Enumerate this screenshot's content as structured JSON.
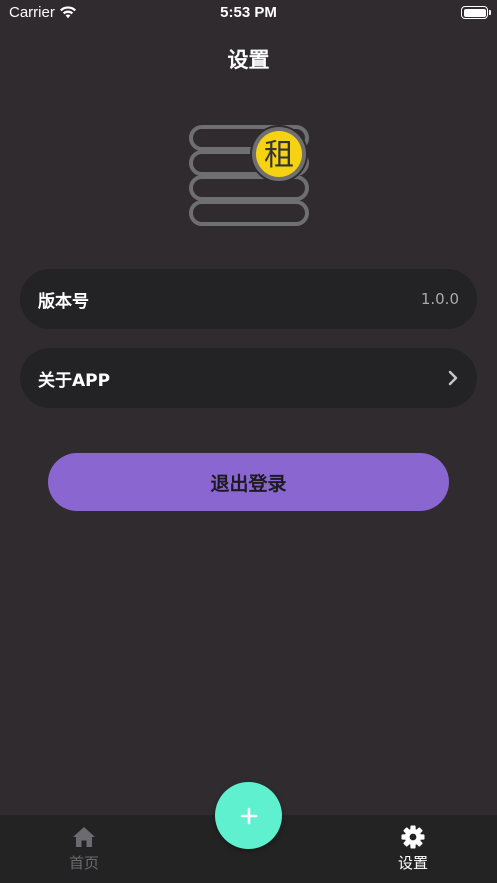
{
  "status_bar": {
    "carrier": "Carrier",
    "time": "5:53 PM",
    "wifi_icon": "wifi-icon",
    "battery_icon": "battery-icon"
  },
  "header": {
    "title": "设置"
  },
  "logo": {
    "icon": "rent-ledger-logo",
    "badge_text": "租",
    "badge_color": "#f5d313",
    "stack_color": "#6f6f72"
  },
  "settings": {
    "rows": [
      {
        "label": "版本号",
        "value": "1.0.0"
      },
      {
        "label": "关于APP",
        "icon": "chevron-right-icon"
      }
    ]
  },
  "logout": {
    "label": "退出登录",
    "color": "#8a66d0"
  },
  "fab": {
    "icon": "plus-icon",
    "color": "#5ef0cf"
  },
  "tab_bar": {
    "tabs": [
      {
        "label": "首页",
        "icon": "home-icon",
        "active": false
      },
      {
        "label": "设置",
        "icon": "gear-icon",
        "active": true
      }
    ]
  },
  "colors": {
    "background": "#2f2b2f",
    "card": "#232325",
    "tab_bar": "#232324",
    "muted_text": "#a9a9ae"
  }
}
